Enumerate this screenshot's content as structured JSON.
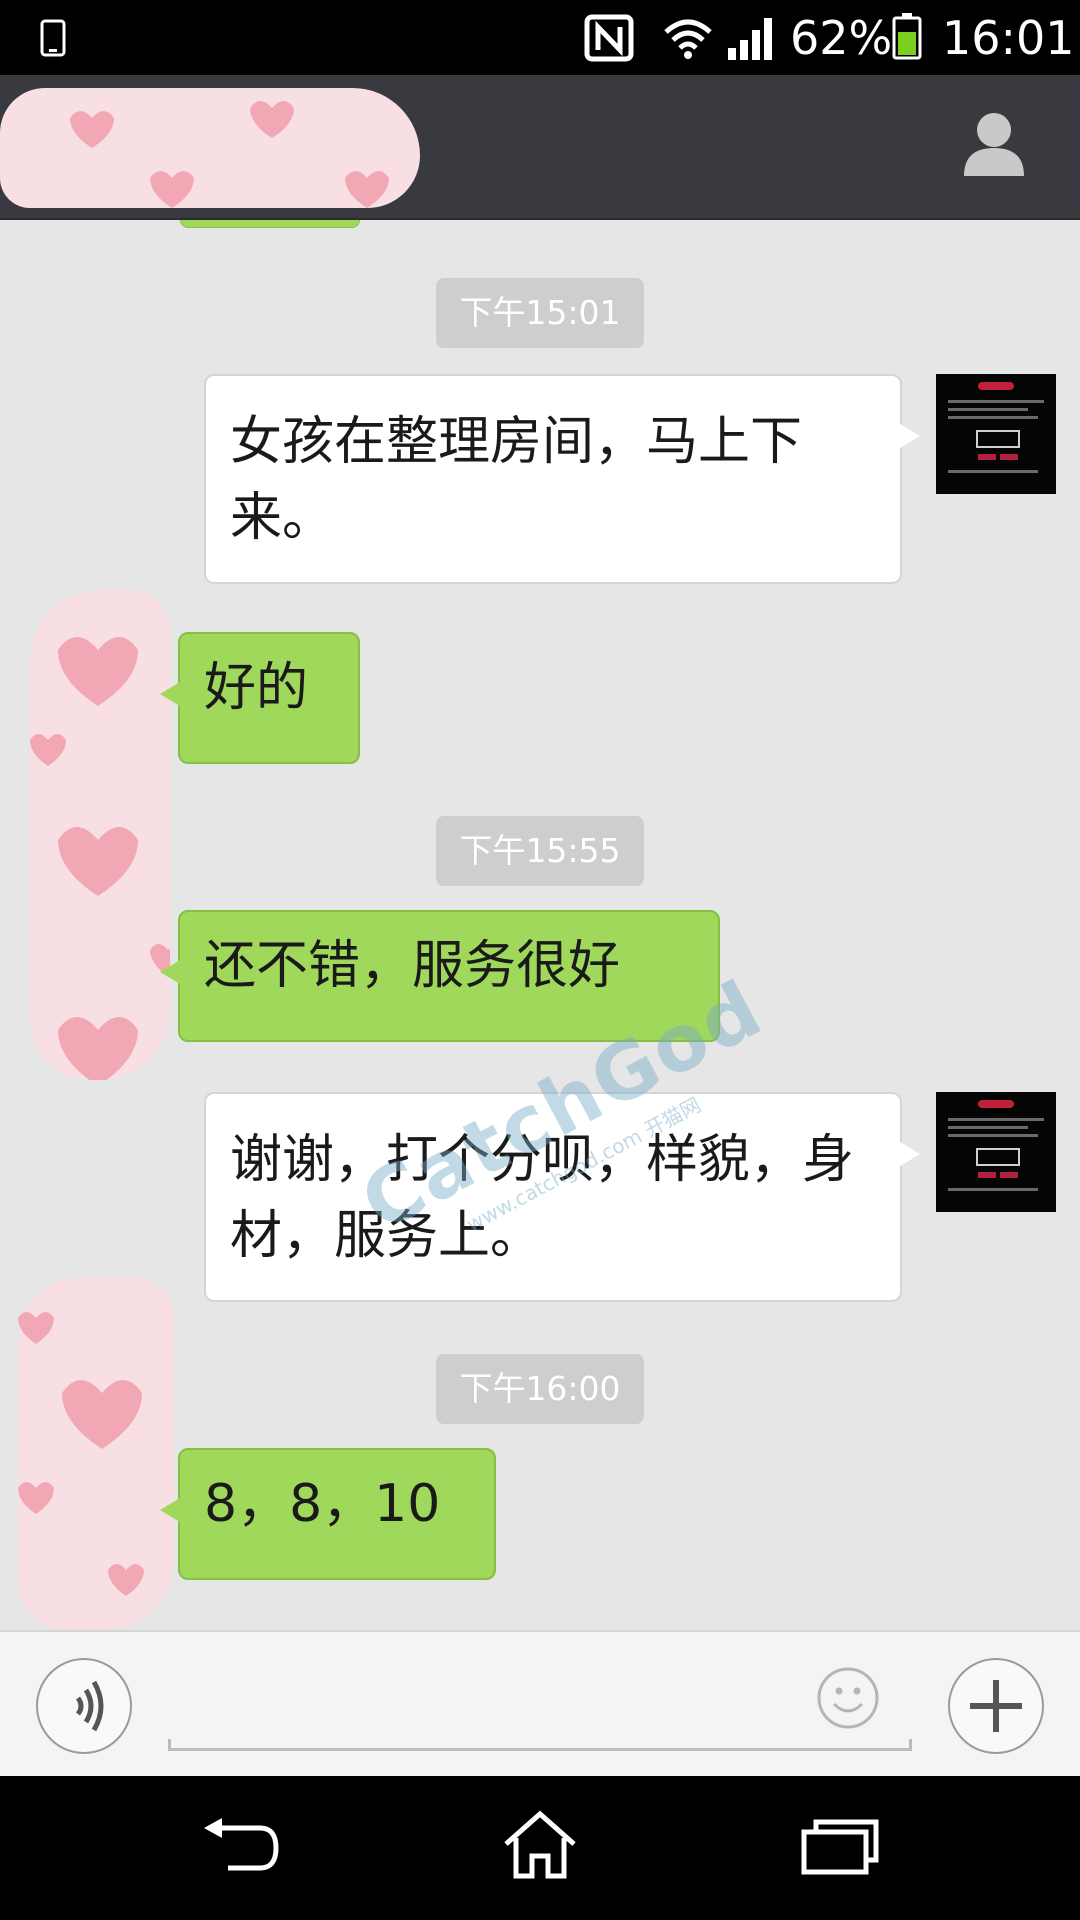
{
  "status_bar": {
    "battery_percent": "62%",
    "time": "16:01",
    "icons": [
      "phone-outline-icon",
      "nfc-icon",
      "wifi-icon",
      "signal-icon",
      "battery-icon"
    ]
  },
  "header": {
    "contact_name_redacted": true,
    "right_icon": "person-icon"
  },
  "messages": [
    {
      "type": "time",
      "text": "下午15:01"
    },
    {
      "type": "sent",
      "text": "女孩在整理房间，马上下来。"
    },
    {
      "type": "received",
      "text": "好的"
    },
    {
      "type": "time",
      "text": "下午15:55"
    },
    {
      "type": "received",
      "text": "还不错，服务很好"
    },
    {
      "type": "sent",
      "text": "谢谢，打个分呗，样貌，身材，服务上。"
    },
    {
      "type": "time",
      "text": "下午16:00"
    },
    {
      "type": "received",
      "text": "8，8，10"
    }
  ],
  "watermark": {
    "brand": "CatchGod",
    "url": "www.catchgod.com 开猫网"
  },
  "input_bar": {
    "left_icon": "voice-icon",
    "emoji_icon": "smiley-icon",
    "right_icon": "plus-icon"
  },
  "nav_bar": {
    "icons": [
      "back-icon",
      "home-icon",
      "recents-icon"
    ]
  },
  "colors": {
    "header_bg": "#393a3f",
    "chat_bg": "#e6e6e6",
    "received_bubble": "#9fd85a",
    "sent_bubble": "#ffffff",
    "time_label_bg": "#cecece"
  }
}
